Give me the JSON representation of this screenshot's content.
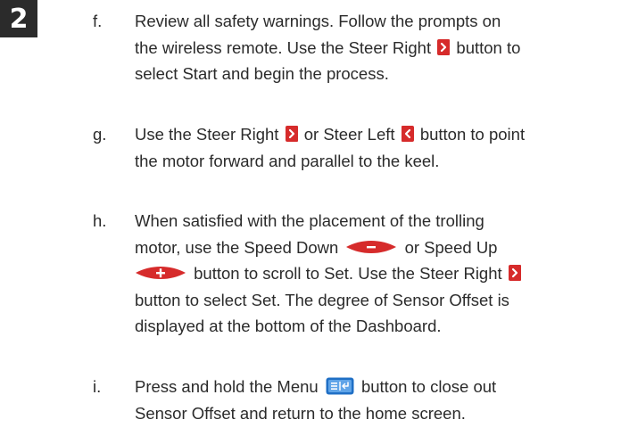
{
  "step_number": "2",
  "items": [
    {
      "letter": "f.",
      "l1": "Review all safety warnings. Follow the prompts on",
      "l2a": "the wireless remote. Use the Steer Right",
      "l2b": "button to",
      "l3": "select Start and begin the process."
    },
    {
      "letter": "g.",
      "l1a": "Use the Steer Right",
      "l1b": "or Steer Left",
      "l1c": "button to point",
      "l2": "the motor forward and parallel to the keel."
    },
    {
      "letter": "h.",
      "l1": "When satisfied with the placement of the trolling",
      "l2a": "motor, use the Speed Down",
      "l2b": "or Speed Up",
      "l3a": "button to scroll to Set. Use the Steer Right",
      "l4": "button to select Set. The degree of Sensor Offset is",
      "l5": "displayed at the bottom of the Dashboard."
    },
    {
      "letter": "i.",
      "l1a": "Press and hold the Menu",
      "l1b": "button to close out",
      "l2": "Sensor Offset and return to the home screen."
    }
  ],
  "colors": {
    "badge": "#2b2b2b",
    "steer_icon": "#d62b2b",
    "speed_icon": "#d62b2b",
    "menu_icon": "#1f6fc5"
  },
  "icons": [
    "steer-right-icon",
    "steer-left-icon",
    "speed-down-icon",
    "speed-up-icon",
    "menu-icon"
  ]
}
